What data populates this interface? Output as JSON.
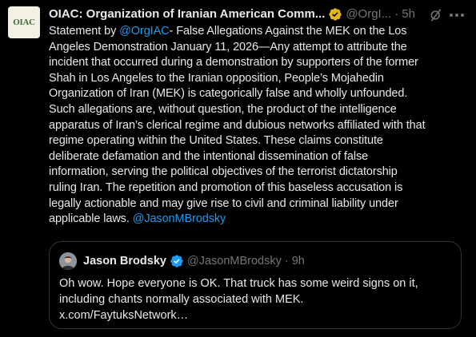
{
  "tweet": {
    "avatar_alt": "OIAC",
    "display_name": "OIAC: Organization of Iranian American Comm...",
    "handle": "@OrgI...",
    "dot": "·",
    "time": "5h",
    "body_lines": [
      [
        {
          "text": "Statement by ",
          "mention": false
        },
        {
          "text": "@OrgIAC",
          "mention": true
        },
        {
          "text": "- False Allegations Against the MEK on the Los",
          "mention": false
        }
      ],
      [
        {
          "text": "Angeles Demonstration January 11, 2026—Any attempt to attribute the",
          "mention": false
        }
      ],
      [
        {
          "text": "incident that occurred during a demonstration by supporters of the former",
          "mention": false
        }
      ],
      [
        {
          "text": "Shah in Los Angeles to the Iranian opposition, People’s Mojahedin",
          "mention": false
        }
      ],
      [
        {
          "text": "Organization of Iran (MEK) is categorically false and wholly unfounded.",
          "mention": false
        }
      ],
      [
        {
          "text": "Such allegations are, without question, the product of the intelligence",
          "mention": false
        }
      ],
      [
        {
          "text": "apparatus of Iran’s clerical regime and dubious networks affiliated with that",
          "mention": false
        }
      ],
      [
        {
          "text": "regime operating within the United States.  These claims constitute",
          "mention": false
        }
      ],
      [
        {
          "text": "deliberate defamation and the intentional dissemination of false",
          "mention": false
        }
      ],
      [
        {
          "text": "information, serving the political objectives of the terrorist dictatorship",
          "mention": false
        }
      ],
      [
        {
          "text": "ruling Iran.  The repetition and promotion of this baseless accusation is",
          "mention": false
        }
      ],
      [
        {
          "text": "legally actionable and may give rise to civil and criminal liability under",
          "mention": false
        }
      ],
      [
        {
          "text": "applicable laws. ",
          "mention": false
        },
        {
          "text": "@JasonMBrodsky",
          "mention": true
        }
      ]
    ]
  },
  "quote": {
    "display_name": "Jason Brodsky",
    "handle": "@JasonMBrodsky",
    "dot": "·",
    "time": "9h",
    "text_lines": [
      "Oh wow. Hope everyone is OK. That truck has some weird signs on it,",
      "including chants normally associated with MEK.",
      "x.com/FaytuksNetwork…"
    ]
  },
  "colors": {
    "background": "#000000",
    "text": "#e7e9ea",
    "secondary": "#71767b",
    "link": "#1d9bf0",
    "verified_gold": "#e2b719",
    "verified_blue": "#1d9bf0",
    "border": "#2f3336"
  },
  "icons": {
    "org_verified": "gold-verified-badge-icon",
    "user_verified": "blue-verified-badge-icon",
    "grok": "grok-icon",
    "more": "more-options-icon"
  }
}
